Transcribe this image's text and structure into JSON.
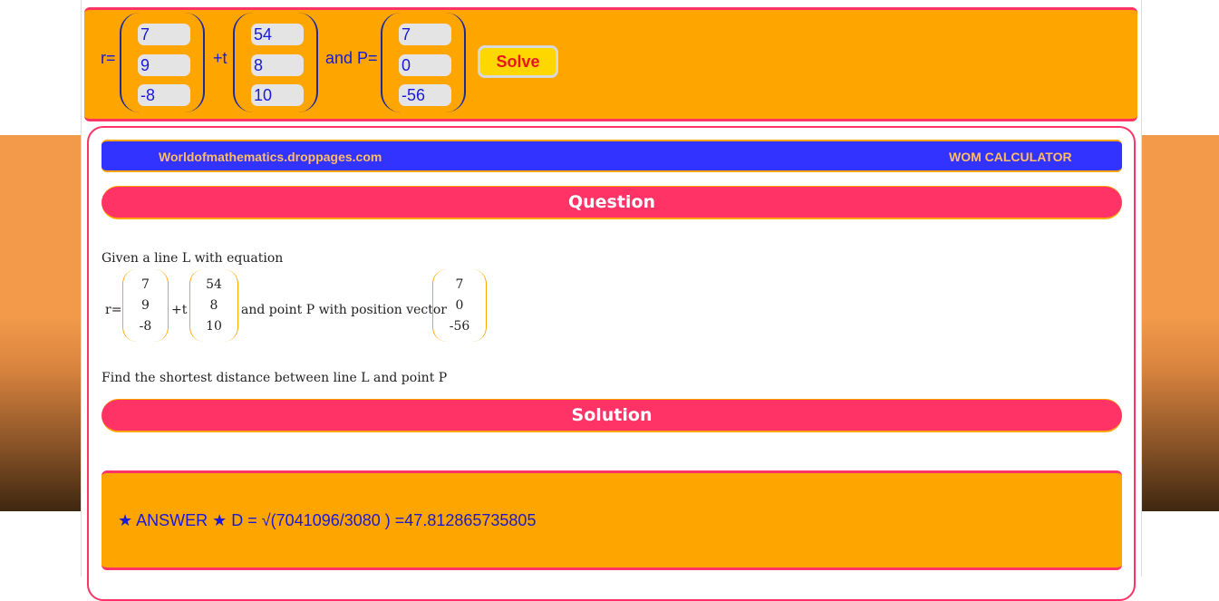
{
  "calculator": {
    "r_label": "r=",
    "t_label": "+t",
    "p_label": "and P=",
    "r_vector": [
      "7",
      "9",
      "-8"
    ],
    "t_vector": [
      "54",
      "8",
      "10"
    ],
    "p_vector": [
      "7",
      "0",
      "-56"
    ],
    "solve_label": "Solve"
  },
  "header": {
    "site": "Worldofmathematics.droppages.com",
    "calculator_name": "WOM CALCULATOR"
  },
  "question": {
    "heading": "Question",
    "intro": "Given a line L with equation",
    "r_label": "r=",
    "t_label": "+t",
    "point_text": "and point P with position vector",
    "r_vector": [
      "7",
      "9",
      "-8"
    ],
    "t_vector": [
      "54",
      "8",
      "10"
    ],
    "p_vector": [
      "7",
      "0",
      "-56"
    ],
    "task": "Find the shortest distance between line L and point P"
  },
  "solution": {
    "heading": "Solution",
    "answer": "★ ANSWER ★ D = √(7041096/3080 ) =47.812865735805"
  },
  "colors": {
    "panel": "#ffa500",
    "accent": "#ff3366",
    "header_bar": "#3333ff",
    "solve_button": "#ffd700"
  }
}
